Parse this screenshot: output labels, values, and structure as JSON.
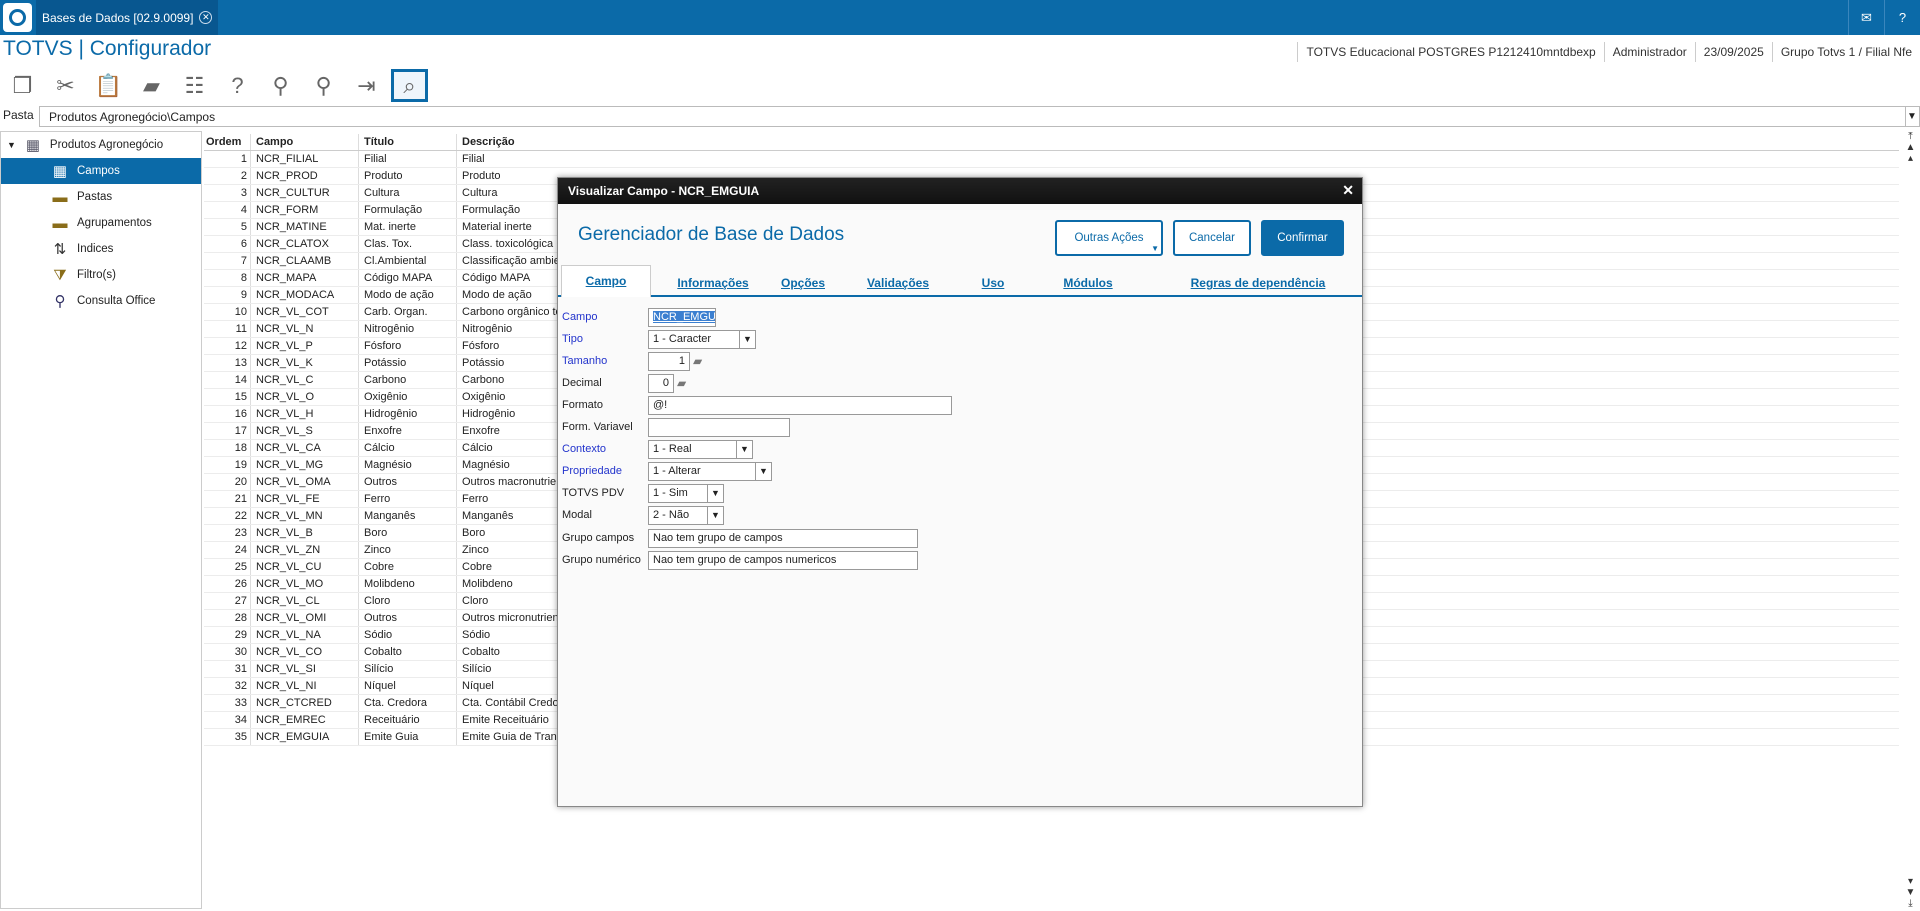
{
  "app": {
    "tab_title": "Bases de Dados [02.9.0099]",
    "title": "TOTVS | Configurador",
    "info": [
      "TOTVS Educacional POSTGRES P1212410mntdbexp",
      "Administrador",
      "23/09/2025",
      "Grupo Totvs 1 / Filial Nfe"
    ]
  },
  "toolbar": {
    "icons": [
      "copy-icon",
      "cut-icon",
      "paste-icon",
      "database-icon",
      "properties-icon",
      "help-icon",
      "search-icon",
      "find-next-icon",
      "exit-icon",
      "view-icon"
    ]
  },
  "pasta": {
    "label": "Pasta",
    "value": "Produtos Agronegócio\\Campos"
  },
  "tree": {
    "root": "Produtos Agronegócio",
    "items": [
      "Campos",
      "Pastas",
      "Agrupamentos",
      "Indices",
      "Filtro(s)",
      "Consulta Office"
    ]
  },
  "grid": {
    "headers": [
      "Ordem",
      "Campo",
      "Título",
      "Descrição"
    ],
    "rows": [
      [
        "1",
        "NCR_FILIAL",
        "Filial",
        "Filial"
      ],
      [
        "2",
        "NCR_PROD",
        "Produto",
        "Produto"
      ],
      [
        "3",
        "NCR_CULTUR",
        "Cultura",
        "Cultura"
      ],
      [
        "4",
        "NCR_FORM",
        "Formulação",
        "Formulação"
      ],
      [
        "5",
        "NCR_MATINE",
        "Mat. inerte",
        "Material inerte"
      ],
      [
        "6",
        "NCR_CLATOX",
        "Clas. Tox.",
        "Class. toxicológica"
      ],
      [
        "7",
        "NCR_CLAAMB",
        "Cl.Ambiental",
        "Classificação ambie"
      ],
      [
        "8",
        "NCR_MAPA",
        "Código MAPA",
        "Código MAPA"
      ],
      [
        "9",
        "NCR_MODACA",
        "Modo de ação",
        "Modo de ação"
      ],
      [
        "10",
        "NCR_VL_COT",
        "Carb. Organ.",
        "Carbono orgânico to"
      ],
      [
        "11",
        "NCR_VL_N",
        "Nitrogênio",
        "Nitrogênio"
      ],
      [
        "12",
        "NCR_VL_P",
        "Fósforo",
        "Fósforo"
      ],
      [
        "13",
        "NCR_VL_K",
        "Potássio",
        "Potássio"
      ],
      [
        "14",
        "NCR_VL_C",
        "Carbono",
        "Carbono"
      ],
      [
        "15",
        "NCR_VL_O",
        "Oxigênio",
        "Oxigênio"
      ],
      [
        "16",
        "NCR_VL_H",
        "Hidrogênio",
        "Hidrogênio"
      ],
      [
        "17",
        "NCR_VL_S",
        "Enxofre",
        "Enxofre"
      ],
      [
        "18",
        "NCR_VL_CA",
        "Cálcio",
        "Cálcio"
      ],
      [
        "19",
        "NCR_VL_MG",
        "Magnésio",
        "Magnésio"
      ],
      [
        "20",
        "NCR_VL_OMA",
        "Outros",
        "Outros macronutrie"
      ],
      [
        "21",
        "NCR_VL_FE",
        "Ferro",
        "Ferro"
      ],
      [
        "22",
        "NCR_VL_MN",
        "Manganês",
        "Manganês"
      ],
      [
        "23",
        "NCR_VL_B",
        "Boro",
        "Boro"
      ],
      [
        "24",
        "NCR_VL_ZN",
        "Zinco",
        "Zinco"
      ],
      [
        "25",
        "NCR_VL_CU",
        "Cobre",
        "Cobre"
      ],
      [
        "26",
        "NCR_VL_MO",
        "Molibdeno",
        "Molibdeno"
      ],
      [
        "27",
        "NCR_VL_CL",
        "Cloro",
        "Cloro"
      ],
      [
        "28",
        "NCR_VL_OMI",
        "Outros",
        "Outros micronutrien"
      ],
      [
        "29",
        "NCR_VL_NA",
        "Sódio",
        "Sódio"
      ],
      [
        "30",
        "NCR_VL_CO",
        "Cobalto",
        "Cobalto"
      ],
      [
        "31",
        "NCR_VL_SI",
        "Silício",
        "Silício"
      ],
      [
        "32",
        "NCR_VL_NI",
        "Níquel",
        "Níquel"
      ],
      [
        "33",
        "NCR_CTCRED",
        "Cta. Credora",
        "Cta. Contábil Credo"
      ],
      [
        "34",
        "NCR_EMREC",
        "Receituário",
        "Emite Receituário"
      ],
      [
        "35",
        "NCR_EMGUIA",
        "Emite Guia",
        "Emite Guia de Trans"
      ]
    ]
  },
  "dialog": {
    "title": "Visualizar Campo - NCR_EMGUIA",
    "heading": "Gerenciador de Base de Dados",
    "btn_outras": "Outras Ações",
    "btn_cancelar": "Cancelar",
    "btn_confirmar": "Confirmar",
    "tabs": [
      "Campo",
      "Informações",
      "Opções",
      "Validações",
      "Uso",
      "Módulos",
      "Regras de dependência"
    ],
    "fields": {
      "campo": {
        "label": "Campo",
        "value": "NCR_EMGU"
      },
      "tipo": {
        "label": "Tipo",
        "value": "1 - Caracter"
      },
      "tamanho": {
        "label": "Tamanho",
        "value": "1"
      },
      "decimal": {
        "label": "Decimal",
        "value": "0"
      },
      "formato": {
        "label": "Formato",
        "value": "@!"
      },
      "form_variavel": {
        "label": "Form. Variavel",
        "value": ""
      },
      "contexto": {
        "label": "Contexto",
        "value": "1 - Real"
      },
      "propriedade": {
        "label": "Propriedade",
        "value": "1 - Alterar"
      },
      "totvs_pdv": {
        "label": "TOTVS PDV",
        "value": "1 - Sim"
      },
      "modal": {
        "label": "Modal",
        "value": "2 - Não"
      },
      "grupo_campos": {
        "label": "Grupo campos",
        "value": "Nao tem grupo de campos"
      },
      "grupo_numerico": {
        "label": "Grupo numérico",
        "value": "Nao tem grupo de campos numericos"
      }
    }
  }
}
